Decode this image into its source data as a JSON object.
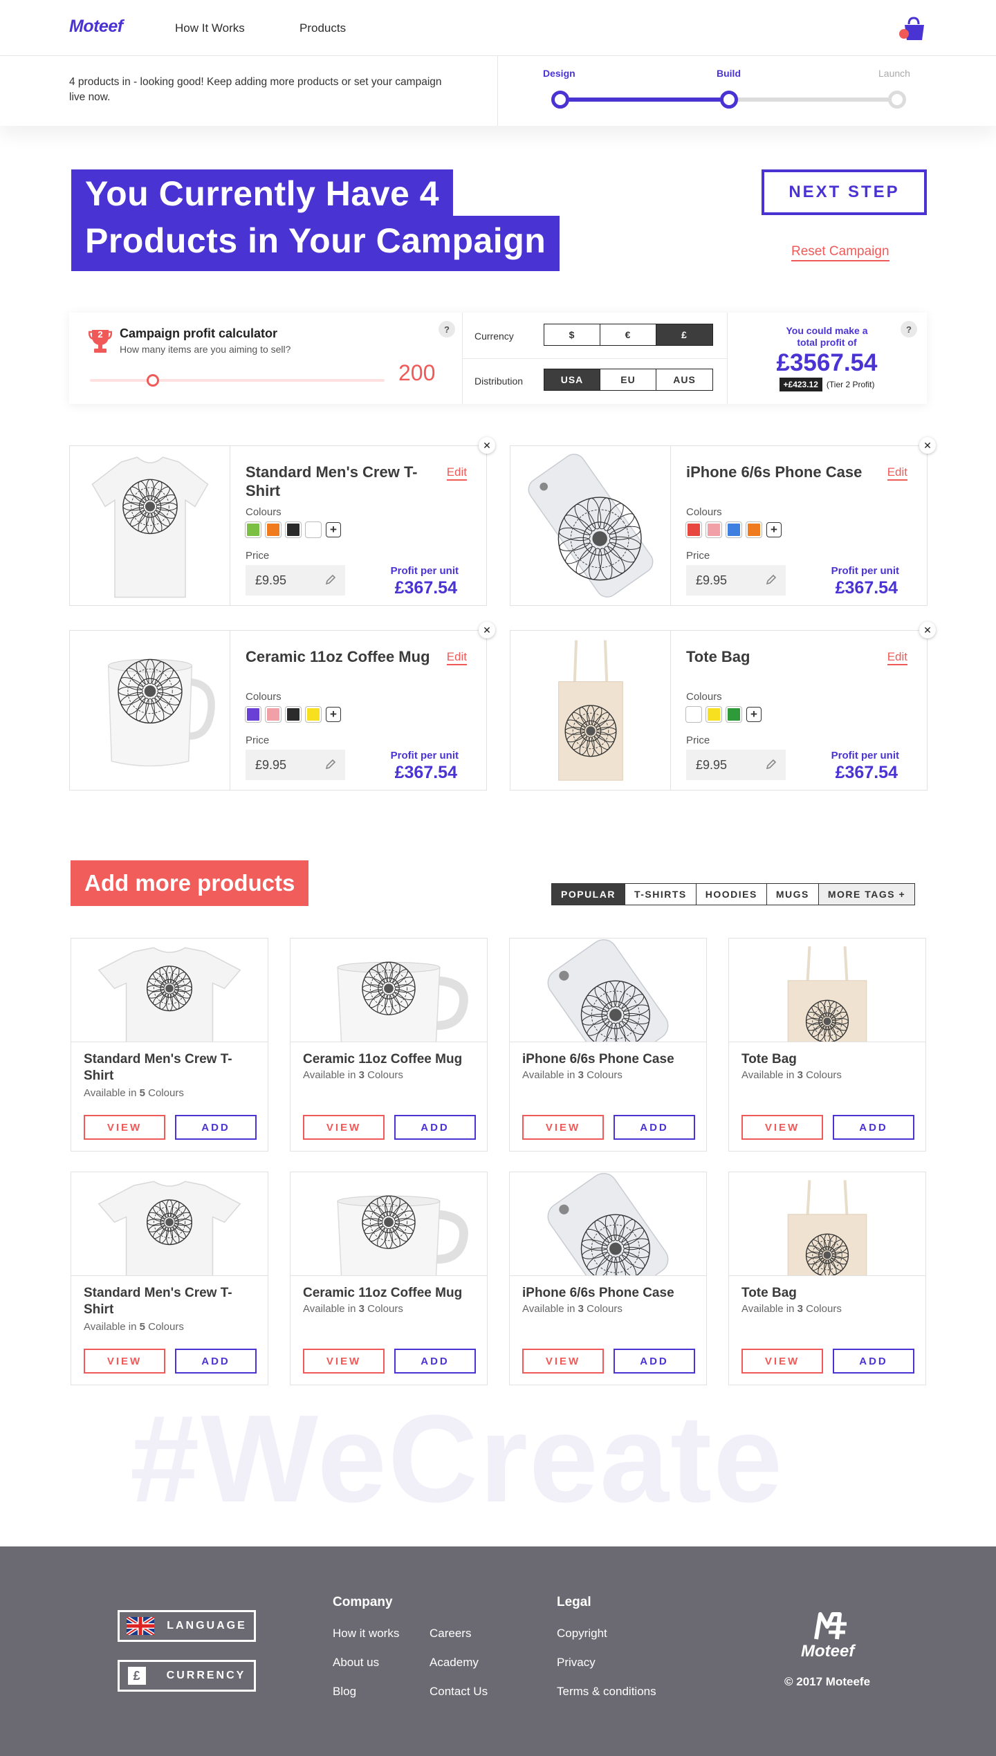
{
  "header": {
    "logo": "Moteef",
    "nav": [
      "How It Works",
      "Products"
    ]
  },
  "status": {
    "message": "4 products in - looking good! Keep adding more products or set your campaign live now.",
    "steps": [
      "Design",
      "Build",
      "Launch"
    ],
    "current_step": "Build"
  },
  "hero": {
    "title_line1": "You Currently Have 4",
    "title_line2": "Products in Your Campaign",
    "next_label": "NEXT STEP",
    "reset_label": "Reset Campaign"
  },
  "calculator": {
    "title": "Campaign profit calculator",
    "subtitle": "How many items are you aiming to sell?",
    "badge": "2",
    "quantity": "200",
    "slider_fraction": 0.2,
    "currency_label": "Currency",
    "currencies": [
      "$",
      "€",
      "£"
    ],
    "currency_selected": "£",
    "distribution_label": "Distribution",
    "distributions": [
      "USA",
      "EU",
      "AUS"
    ],
    "distribution_selected": "USA",
    "help": "?",
    "result_line1": "You could make a",
    "result_line2": "total profit of",
    "total": "£3567.54",
    "bonus": "+£423.12",
    "tier": "(Tier 2 Profit)"
  },
  "campaign_products": [
    {
      "name": "Standard Men's Crew T-Shirt",
      "edit": "Edit",
      "colours_label": "Colours",
      "colours": [
        "#7bc043",
        "#f07b1f",
        "#2b2b2b",
        "#ffffff"
      ],
      "price_label": "Price",
      "price": "£9.95",
      "ppu_label": "Profit per unit",
      "ppu": "£367.54",
      "image": "tshirt"
    },
    {
      "name": "iPhone 6/6s Phone Case",
      "edit": "Edit",
      "colours_label": "Colours",
      "colours": [
        "#e8473f",
        "#f2a0a8",
        "#3f7fe0",
        "#f07b1f"
      ],
      "price_label": "Price",
      "price": "£9.95",
      "ppu_label": "Profit per unit",
      "ppu": "£367.54",
      "image": "phone"
    },
    {
      "name": "Ceramic 11oz Coffee Mug",
      "edit": "Edit",
      "colours_label": "Colours",
      "colours": [
        "#6a3fd6",
        "#f2a0a8",
        "#2b2b2b",
        "#f6e020"
      ],
      "price_label": "Price",
      "price": "£9.95",
      "ppu_label": "Profit per unit",
      "ppu": "£367.54",
      "image": "mug"
    },
    {
      "name": "Tote Bag",
      "edit": "Edit",
      "colours_label": "Colours",
      "colours": [
        "#ffffff",
        "#f6e020",
        "#2f9a3a"
      ],
      "price_label": "Price",
      "price": "£9.95",
      "ppu_label": "Profit per unit",
      "ppu": "£367.54",
      "image": "tote"
    }
  ],
  "more": {
    "title": "Add more products",
    "tags": [
      "POPULAR",
      "T-SHIRTS",
      "HOODIES",
      "MUGS",
      "MORE TAGS +"
    ],
    "tag_selected": "POPULAR",
    "view_label": "VIEW",
    "add_label": "ADD",
    "cards": [
      {
        "name": "Standard Men's Crew T-Shirt",
        "avail_pre": "Available in ",
        "count": "5",
        "avail_post": " Colours",
        "image": "tshirt"
      },
      {
        "name": "Ceramic 11oz Coffee Mug",
        "avail_pre": "Available in ",
        "count": "3",
        "avail_post": " Colours",
        "image": "mug"
      },
      {
        "name": "iPhone 6/6s Phone Case",
        "avail_pre": "Available in ",
        "count": "3",
        "avail_post": " Colours",
        "image": "phone"
      },
      {
        "name": "Tote Bag",
        "avail_pre": "Available in ",
        "count": "3",
        "avail_post": " Colours",
        "image": "tote"
      },
      {
        "name": "Standard Men's Crew T-Shirt",
        "avail_pre": "Available in ",
        "count": "5",
        "avail_post": " Colours",
        "image": "tshirt"
      },
      {
        "name": "Ceramic 11oz Coffee Mug",
        "avail_pre": "Available in ",
        "count": "3",
        "avail_post": " Colours",
        "image": "mug"
      },
      {
        "name": "iPhone 6/6s Phone Case",
        "avail_pre": "Available in ",
        "count": "3",
        "avail_post": " Colours",
        "image": "phone"
      },
      {
        "name": "Tote Bag",
        "avail_pre": "Available in ",
        "count": "3",
        "avail_post": " Colours",
        "image": "tote"
      }
    ]
  },
  "watermark": "#WeCreate",
  "footer": {
    "language": "LANGUAGE",
    "currency": "CURRENCY",
    "currency_symbol": "£",
    "company_title": "Company",
    "company_links": [
      "How it works",
      "Careers",
      "About us",
      "Academy",
      "Blog",
      "Contact Us"
    ],
    "legal_title": "Legal",
    "legal_links": [
      "Copyright",
      "Privacy",
      "Terms & conditions"
    ],
    "brand": "Moteef",
    "copyright": "© 2017 Moteefe"
  },
  "colors": {
    "accent": "#4a33d3",
    "coral": "#ef5a58",
    "footer": "#6b6a72"
  }
}
